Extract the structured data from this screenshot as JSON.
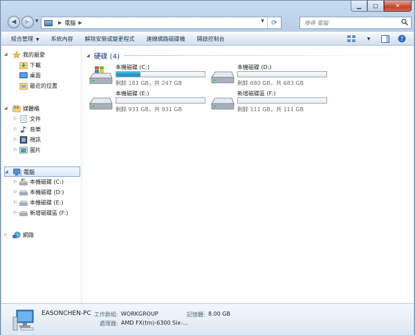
{
  "window": {
    "caption": {
      "minimize": "▁",
      "maximize": "□",
      "close": "✕"
    }
  },
  "address_bar": {
    "crumbs": [
      "電腦"
    ],
    "search_placeholder": "搜尋 電腦"
  },
  "command_bar": {
    "items": [
      "組合管理",
      "系統內容",
      "解除安裝或變更程式",
      "連線網路磁碟機",
      "開啟控制台"
    ],
    "organize_has_dropdown": true
  },
  "sidebar": {
    "favorites": {
      "label": "我的最愛",
      "items": [
        "下載",
        "桌面",
        "最近的位置"
      ]
    },
    "libraries": {
      "label": "媒體櫃",
      "items": [
        "文件",
        "音樂",
        "視訊",
        "圖片"
      ]
    },
    "computer": {
      "label": "電腦",
      "items": [
        "本機磁碟 (C:)",
        "本機磁碟 (D:)",
        "本機磁碟 (E:)",
        "新增磁碟區 (F:)"
      ]
    },
    "network": {
      "label": "網路"
    }
  },
  "content": {
    "group_title": "硬碟 (4)",
    "drives": [
      {
        "name": "本機磁碟 (C:)",
        "free_text": "剩餘 181 GB，共 247 GB",
        "used_fraction": 0.27,
        "icon": "windows-drive-icon"
      },
      {
        "name": "本機磁碟 (D:)",
        "free_text": "剩餘 680 GB，共 683 GB",
        "used_fraction": 0.0,
        "icon": "hard-drive-icon"
      },
      {
        "name": "本機磁碟 (E:)",
        "free_text": "剩餘 931 GB，共 931 GB",
        "used_fraction": 0.0,
        "icon": "hard-drive-icon"
      },
      {
        "name": "新增磁碟區 (F:)",
        "free_text": "剩餘 111 GB，共 111 GB",
        "used_fraction": 0.0,
        "icon": "hard-drive-icon"
      }
    ]
  },
  "details": {
    "computer_name": "EASONCHEN-PC",
    "workgroup_label": "工作群組:",
    "workgroup": "WORKGROUP",
    "memory_label": "記憶體:",
    "memory": "8.00 GB",
    "processor_label": "處理器:",
    "processor": "AMD FX(tm)-6300 Six-..."
  },
  "colors": {
    "accent": "#1e3a8a",
    "progress": "#2692c8",
    "selection": "#dceafb"
  }
}
